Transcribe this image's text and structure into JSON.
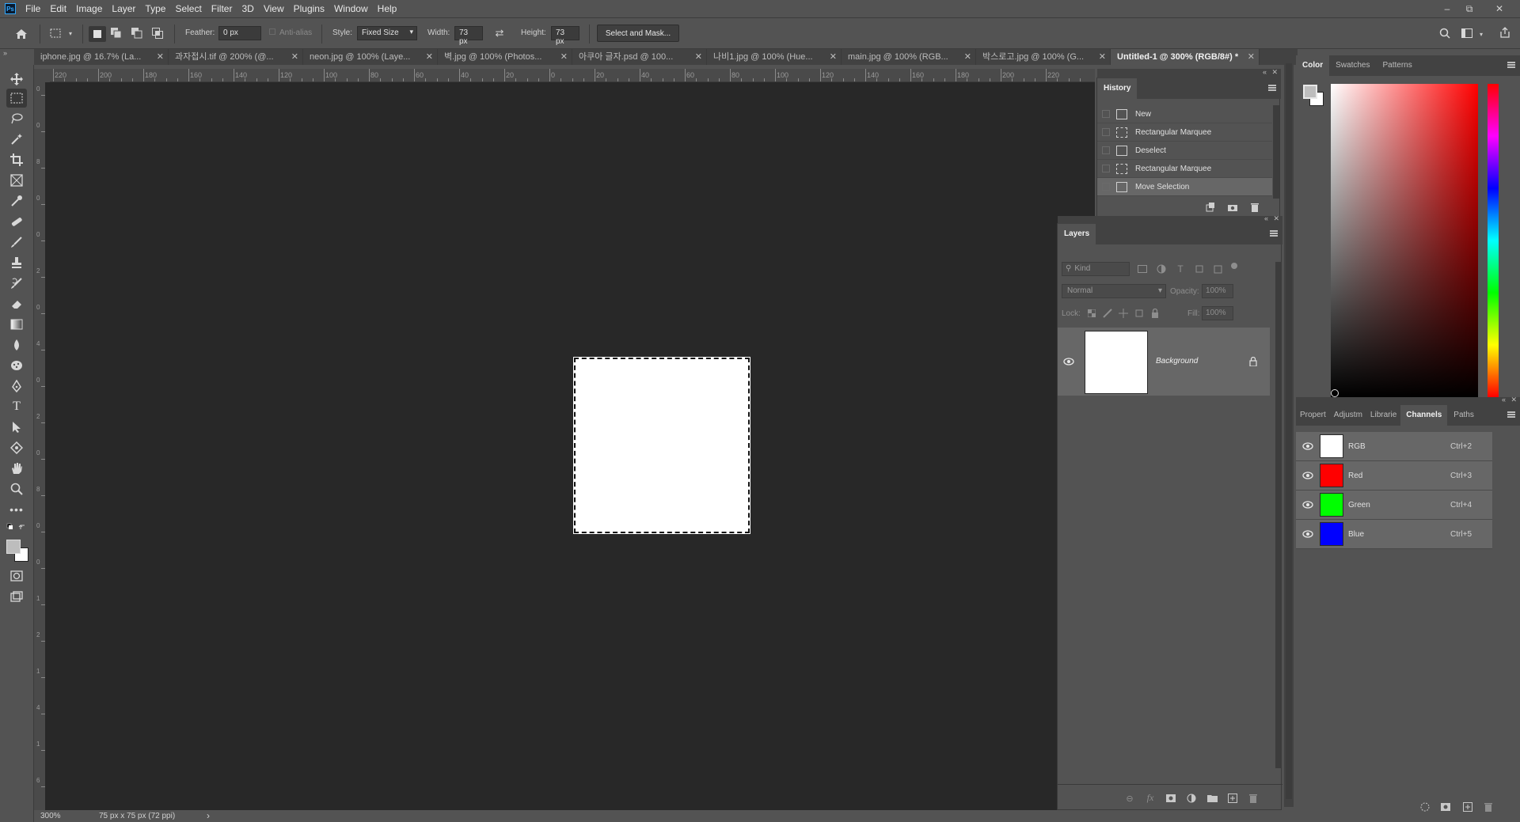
{
  "menu": {
    "items": [
      "File",
      "Edit",
      "Image",
      "Layer",
      "Type",
      "Select",
      "Filter",
      "3D",
      "View",
      "Plugins",
      "Window",
      "Help"
    ],
    "logo_text": "Ps"
  },
  "window_controls": {
    "minimize": "–",
    "restore": "⧉",
    "close": "✕"
  },
  "options": {
    "feather_label": "Feather:",
    "feather_value": "0 px",
    "antialias_label": "Anti-alias",
    "style_label": "Style:",
    "style_value": "Fixed Size",
    "width_label": "Width:",
    "width_value": "73 px",
    "height_label": "Height:",
    "height_value": "73 px",
    "select_mask_label": "Select and Mask..."
  },
  "tabs": [
    {
      "label": "iphone.jpg @ 16.7% (La...",
      "close": "✕"
    },
    {
      "label": "과자접시.tif @ 200% (@...",
      "close": "✕"
    },
    {
      "label": "neon.jpg @ 100% (Laye...",
      "close": "✕"
    },
    {
      "label": "벽.jpg @ 100% (Photos...",
      "close": "✕"
    },
    {
      "label": "아쿠아 글자.psd @ 100...",
      "close": "✕"
    },
    {
      "label": "나비1.jpg @ 100% (Hue...",
      "close": "✕"
    },
    {
      "label": "main.jpg @ 100% (RGB...",
      "close": "✕"
    },
    {
      "label": "박스로고.jpg @ 100% (G...",
      "close": "✕"
    },
    {
      "label": "Untitled-1 @ 300% (RGB/8#) *",
      "close": "✕"
    }
  ],
  "ruler_top": [
    "220",
    "200",
    "180",
    "160",
    "140",
    "120",
    "100",
    "80",
    "60",
    "40",
    "20",
    "0",
    "20",
    "40",
    "60",
    "80",
    "100",
    "120",
    "140",
    "160",
    "180",
    "200",
    "220"
  ],
  "ruler_left": [
    "0",
    "0",
    "8",
    "0",
    "0",
    "2",
    "0",
    "4",
    "0",
    "2",
    "0",
    "8",
    "0",
    "0",
    "1",
    "2",
    "1",
    "4",
    "1",
    "6"
  ],
  "status": {
    "zoom": "300%",
    "doc_info": "75 px x 75 px (72 ppi)",
    "arrow": "›"
  },
  "history": {
    "title": "History",
    "items": [
      "New",
      "Rectangular Marquee",
      "Deselect",
      "Rectangular Marquee",
      "Move Selection"
    ],
    "active_index": 4
  },
  "layers": {
    "title": "Layers",
    "kind_placeholder": "Kind",
    "blend_mode": "Normal",
    "opacity_label": "Opacity:",
    "opacity_value": "100%",
    "lock_label": "Lock:",
    "fill_label": "Fill:",
    "fill_value": "100%",
    "items": [
      {
        "name": "Background"
      }
    ]
  },
  "color_panel": {
    "tabs": [
      "Color",
      "Swatches",
      "Patterns"
    ],
    "hue_color": "#ff0000"
  },
  "channels_panel": {
    "tabs": [
      "Propert",
      "Adjustm",
      "Librarie",
      "Channels",
      "Paths"
    ],
    "items": [
      {
        "name": "RGB",
        "shortcut": "Ctrl+2",
        "color": "#ffffff"
      },
      {
        "name": "Red",
        "shortcut": "Ctrl+3",
        "color": "#ff0000"
      },
      {
        "name": "Green",
        "shortcut": "Ctrl+4",
        "color": "#00ff00"
      },
      {
        "name": "Blue",
        "shortcut": "Ctrl+5",
        "color": "#0000ff"
      }
    ]
  }
}
